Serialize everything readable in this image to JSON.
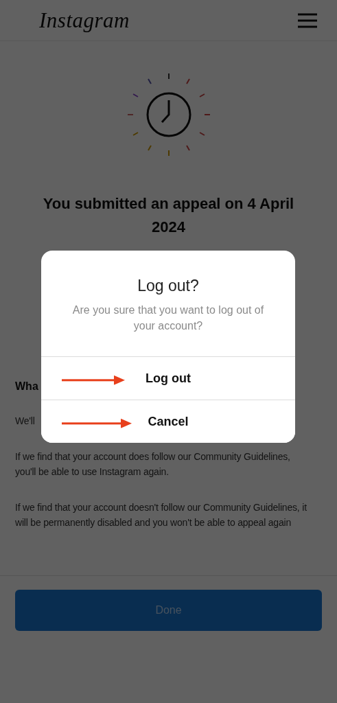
{
  "header": {
    "logo": "Instagram"
  },
  "appeal": {
    "title": "You submitted an appeal on 4 April 2024",
    "heading": "Wha",
    "paragraphs": [
      "We'll",
      "If we find that your account does follow our Community Guidelines, you'll be able to use Instagram again.",
      "If we find that your account doesn't follow our Community Guidelines, it will be permanently disabled and you won't be able to appeal again"
    ]
  },
  "done_button": {
    "label": "Done"
  },
  "dialog": {
    "title": "Log out?",
    "message": "Are you sure that you want to log out of your account?",
    "actions": [
      {
        "label": "Log out",
        "bold": true,
        "annotated": true
      },
      {
        "label": "Cancel",
        "bold": true,
        "annotated": true
      }
    ]
  }
}
